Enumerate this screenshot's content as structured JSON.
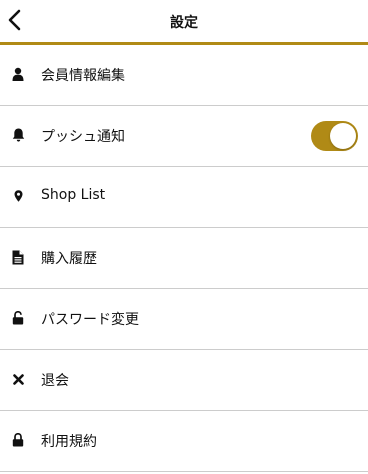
{
  "header": {
    "title": "設定",
    "back_icon": "chevron-left-icon",
    "accent_color": "#b08a16"
  },
  "menu": [
    {
      "id": "profile",
      "label": "会員情報編集",
      "icon": "user-icon"
    },
    {
      "id": "push",
      "label": "プッシュ通知",
      "icon": "bell-icon",
      "toggle": {
        "on": true
      }
    },
    {
      "id": "shops",
      "label": "Shop List",
      "icon": "map-pin-icon"
    },
    {
      "id": "history",
      "label": "購入履歴",
      "icon": "document-icon"
    },
    {
      "id": "password",
      "label": "パスワード変更",
      "icon": "unlock-icon"
    },
    {
      "id": "withdraw",
      "label": "退会",
      "icon": "close-icon"
    },
    {
      "id": "terms",
      "label": "利用規約",
      "icon": "lock-icon"
    }
  ]
}
